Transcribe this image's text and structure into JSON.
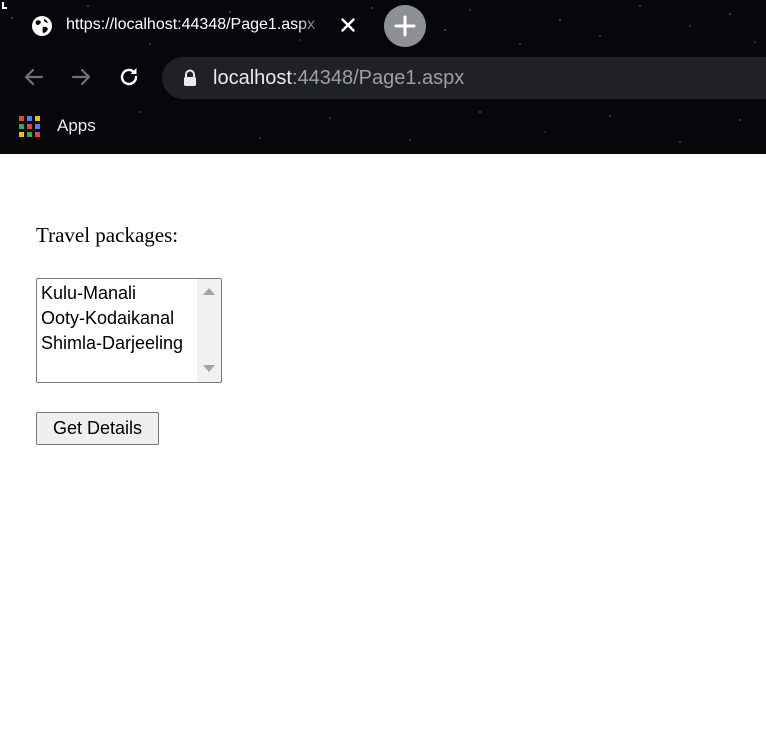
{
  "browser": {
    "tab": {
      "title": "https://localhost:44348/Page1.aspx",
      "favicon": "globe-icon",
      "close_icon": "close-icon"
    },
    "new_tab_icon": "plus-icon",
    "nav": {
      "back_icon": "arrow-left-icon",
      "forward_icon": "arrow-right-icon",
      "reload_icon": "reload-icon"
    },
    "address_bar": {
      "lock_icon": "lock-icon",
      "host": "localhost",
      "rest": ":44348/Page1.aspx"
    },
    "bookmarks": {
      "apps_icon": "apps-grid-icon",
      "apps_label": "Apps"
    },
    "colors": {
      "chrome_background": "#06070b",
      "omnibox_background": "#202124",
      "new_tab_button": "#8d9096",
      "apps_grid": [
        "#ea4335",
        "#4285f4",
        "#fbbc05",
        "#34a853",
        "#ea4335",
        "#4285f4",
        "#fbbc05",
        "#34a853",
        "#ea4335"
      ]
    }
  },
  "page": {
    "heading": "Travel packages:",
    "listbox": {
      "options": [
        "Kulu-Manali",
        "Ooty-Kodaikanal",
        "Shimla-Darjeeling"
      ]
    },
    "button_label": "Get Details"
  }
}
